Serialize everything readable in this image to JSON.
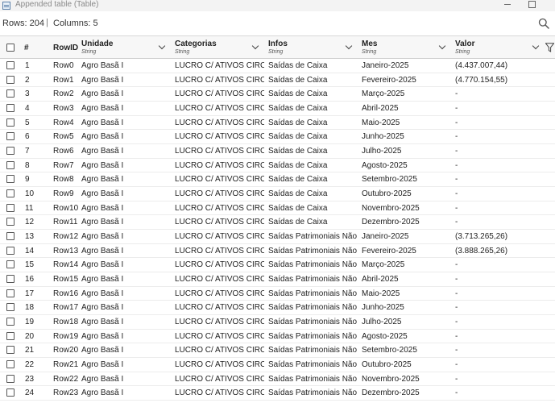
{
  "window": {
    "title": "Appended table (Table)"
  },
  "status": {
    "rows": "Rows: 204",
    "separator": "|",
    "columns": "Columns: 5"
  },
  "columns": {
    "num": "#",
    "rowid": "RowID",
    "unidade": {
      "name": "Unidade",
      "type": "String"
    },
    "categorias": {
      "name": "Categorias",
      "type": "String"
    },
    "infos": {
      "name": "Infos",
      "type": "String"
    },
    "mes": {
      "name": "Mes",
      "type": "String"
    },
    "valor": {
      "name": "Valor",
      "type": "String"
    }
  },
  "rows": [
    {
      "num": "1",
      "rowid": "Row0",
      "unidade": "Agro Basã I",
      "categorias": "LUCRO C/ ATIVOS CIRCULANTES",
      "infos": "Saídas de Caixa",
      "mes": "Janeiro-2025",
      "valor": "(4.437.007,44)"
    },
    {
      "num": "2",
      "rowid": "Row1",
      "unidade": "Agro Basã I",
      "categorias": "LUCRO C/ ATIVOS CIRCULANTES",
      "infos": "Saídas de Caixa",
      "mes": "Fevereiro-2025",
      "valor": "(4.770.154,55)"
    },
    {
      "num": "3",
      "rowid": "Row2",
      "unidade": "Agro Basã I",
      "categorias": "LUCRO C/ ATIVOS CIRCULANTES",
      "infos": "Saídas de Caixa",
      "mes": "Março-2025",
      "valor": "-"
    },
    {
      "num": "4",
      "rowid": "Row3",
      "unidade": "Agro Basã I",
      "categorias": "LUCRO C/ ATIVOS CIRCULANTES",
      "infos": "Saídas de Caixa",
      "mes": "Abril-2025",
      "valor": "-"
    },
    {
      "num": "5",
      "rowid": "Row4",
      "unidade": "Agro Basã I",
      "categorias": "LUCRO C/ ATIVOS CIRCULANTES",
      "infos": "Saídas de Caixa",
      "mes": "Maio-2025",
      "valor": "-"
    },
    {
      "num": "6",
      "rowid": "Row5",
      "unidade": "Agro Basã I",
      "categorias": "LUCRO C/ ATIVOS CIRCULANTES",
      "infos": "Saídas de Caixa",
      "mes": "Junho-2025",
      "valor": "-"
    },
    {
      "num": "7",
      "rowid": "Row6",
      "unidade": "Agro Basã I",
      "categorias": "LUCRO C/ ATIVOS CIRCULANTES",
      "infos": "Saídas de Caixa",
      "mes": "Julho-2025",
      "valor": "-"
    },
    {
      "num": "8",
      "rowid": "Row7",
      "unidade": "Agro Basã I",
      "categorias": "LUCRO C/ ATIVOS CIRCULANTES",
      "infos": "Saídas de Caixa",
      "mes": "Agosto-2025",
      "valor": "-"
    },
    {
      "num": "9",
      "rowid": "Row8",
      "unidade": "Agro Basã I",
      "categorias": "LUCRO C/ ATIVOS CIRCULANTES",
      "infos": "Saídas de Caixa",
      "mes": "Setembro-2025",
      "valor": "-"
    },
    {
      "num": "10",
      "rowid": "Row9",
      "unidade": "Agro Basã I",
      "categorias": "LUCRO C/ ATIVOS CIRCULANTES",
      "infos": "Saídas de Caixa",
      "mes": "Outubro-2025",
      "valor": "-"
    },
    {
      "num": "11",
      "rowid": "Row10",
      "unidade": "Agro Basã I",
      "categorias": "LUCRO C/ ATIVOS CIRCULANTES",
      "infos": "Saídas de Caixa",
      "mes": "Novembro-2025",
      "valor": "-"
    },
    {
      "num": "12",
      "rowid": "Row11",
      "unidade": "Agro Basã I",
      "categorias": "LUCRO C/ ATIVOS CIRCULANTES",
      "infos": "Saídas de Caixa",
      "mes": "Dezembro-2025",
      "valor": "-"
    },
    {
      "num": "13",
      "rowid": "Row12",
      "unidade": "Agro Basã I",
      "categorias": "LUCRO C/ ATIVOS CIRCULANTES",
      "infos": "Saídas Patrimoniais Não Desembolsáveis",
      "mes": "Janeiro-2025",
      "valor": "(3.713.265,26)"
    },
    {
      "num": "14",
      "rowid": "Row13",
      "unidade": "Agro Basã I",
      "categorias": "LUCRO C/ ATIVOS CIRCULANTES",
      "infos": "Saídas Patrimoniais Não Desembolsáveis",
      "mes": "Fevereiro-2025",
      "valor": "(3.888.265,26)"
    },
    {
      "num": "15",
      "rowid": "Row14",
      "unidade": "Agro Basã I",
      "categorias": "LUCRO C/ ATIVOS CIRCULANTES",
      "infos": "Saídas Patrimoniais Não Desembolsáveis",
      "mes": "Março-2025",
      "valor": "-"
    },
    {
      "num": "16",
      "rowid": "Row15",
      "unidade": "Agro Basã I",
      "categorias": "LUCRO C/ ATIVOS CIRCULANTES",
      "infos": "Saídas Patrimoniais Não Desembolsáveis",
      "mes": "Abril-2025",
      "valor": "-"
    },
    {
      "num": "17",
      "rowid": "Row16",
      "unidade": "Agro Basã I",
      "categorias": "LUCRO C/ ATIVOS CIRCULANTES",
      "infos": "Saídas Patrimoniais Não Desembolsáveis",
      "mes": "Maio-2025",
      "valor": "-"
    },
    {
      "num": "18",
      "rowid": "Row17",
      "unidade": "Agro Basã I",
      "categorias": "LUCRO C/ ATIVOS CIRCULANTES",
      "infos": "Saídas Patrimoniais Não Desembolsáveis",
      "mes": "Junho-2025",
      "valor": "-"
    },
    {
      "num": "19",
      "rowid": "Row18",
      "unidade": "Agro Basã I",
      "categorias": "LUCRO C/ ATIVOS CIRCULANTES",
      "infos": "Saídas Patrimoniais Não Desembolsáveis",
      "mes": "Julho-2025",
      "valor": "-"
    },
    {
      "num": "20",
      "rowid": "Row19",
      "unidade": "Agro Basã I",
      "categorias": "LUCRO C/ ATIVOS CIRCULANTES",
      "infos": "Saídas Patrimoniais Não Desembolsáveis",
      "mes": "Agosto-2025",
      "valor": "-"
    },
    {
      "num": "21",
      "rowid": "Row20",
      "unidade": "Agro Basã I",
      "categorias": "LUCRO C/ ATIVOS CIRCULANTES",
      "infos": "Saídas Patrimoniais Não Desembolsáveis",
      "mes": "Setembro-2025",
      "valor": "-"
    },
    {
      "num": "22",
      "rowid": "Row21",
      "unidade": "Agro Basã I",
      "categorias": "LUCRO C/ ATIVOS CIRCULANTES",
      "infos": "Saídas Patrimoniais Não Desembolsáveis",
      "mes": "Outubro-2025",
      "valor": "-"
    },
    {
      "num": "23",
      "rowid": "Row22",
      "unidade": "Agro Basã I",
      "categorias": "LUCRO C/ ATIVOS CIRCULANTES",
      "infos": "Saídas Patrimoniais Não Desembolsáveis",
      "mes": "Novembro-2025",
      "valor": "-"
    },
    {
      "num": "24",
      "rowid": "Row23",
      "unidade": "Agro Basã I",
      "categorias": "LUCRO C/ ATIVOS CIRCULANTES",
      "infos": "Saídas Patrimoniais Não Desembolsáveis",
      "mes": "Dezembro-2025",
      "valor": "-"
    }
  ],
  "icons": {
    "app": "table-icon",
    "search": "search-icon",
    "filter": "filter-icon",
    "sort": "chevron-down-icon"
  }
}
